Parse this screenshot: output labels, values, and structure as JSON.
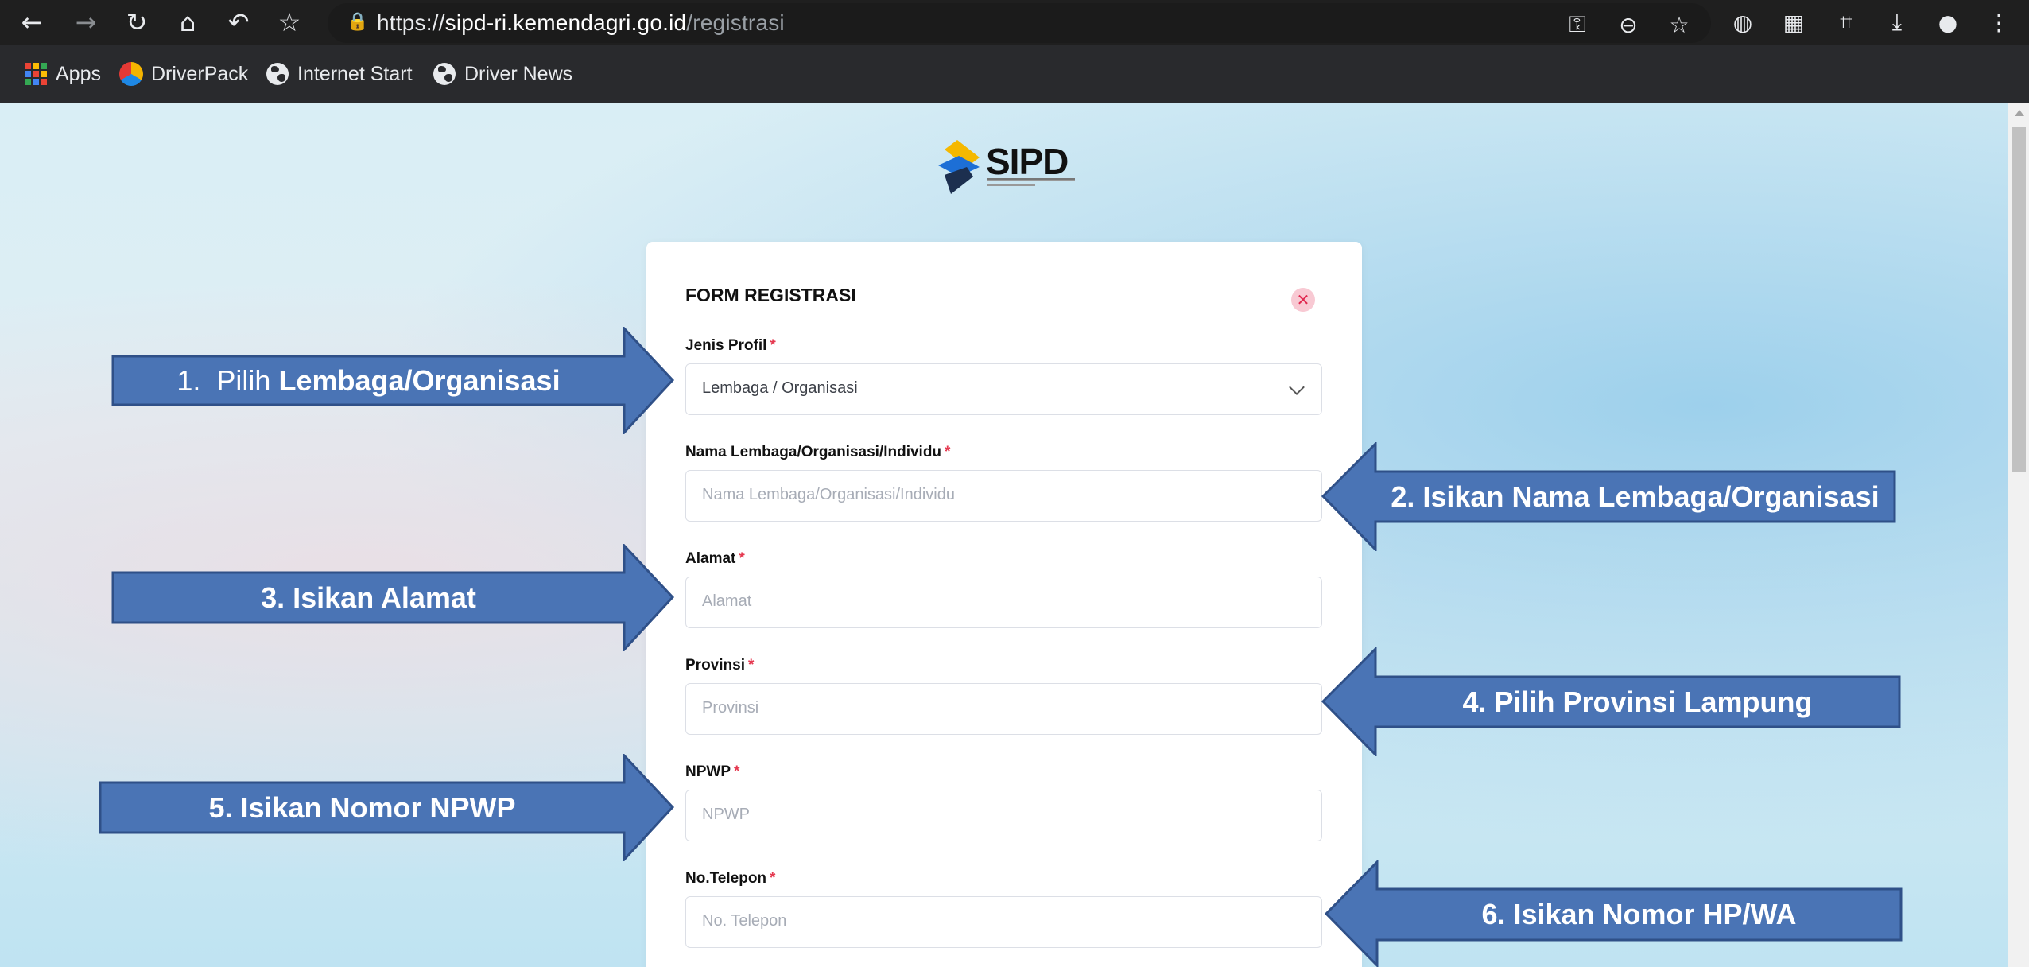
{
  "browser": {
    "url_scheme": "https://",
    "url_host": "sipd-ri.kemendagri.go.id",
    "url_path": "/registrasi",
    "bookmarks": [
      {
        "label": "Apps",
        "icon": "apps-grid-icon"
      },
      {
        "label": "DriverPack",
        "icon": "driverpack-icon"
      },
      {
        "label": "Internet Start",
        "icon": "globe-icon"
      },
      {
        "label": "Driver News",
        "icon": "globe-icon"
      }
    ]
  },
  "logo": {
    "text": "SIPD",
    "colors": {
      "yellow": "#f5b800",
      "blue": "#1d6fd6",
      "navy": "#1c2f4f"
    }
  },
  "form": {
    "title": "FORM REGISTRASI",
    "required_mark": "*",
    "fields": [
      {
        "label": "Jenis Profil",
        "value": "Lembaga / Organisasi",
        "type": "select"
      },
      {
        "label": "Nama Lembaga/Organisasi/Individu",
        "placeholder": "Nama Lembaga/Organisasi/Individu"
      },
      {
        "label": "Alamat",
        "placeholder": "Alamat"
      },
      {
        "label": "Provinsi",
        "placeholder": "Provinsi"
      },
      {
        "label": "NPWP",
        "placeholder": "NPWP"
      },
      {
        "label": "No.Telepon",
        "placeholder": "No. Telepon"
      }
    ]
  },
  "annotations": [
    {
      "prefix": "1.  Pilih ",
      "bold": "Lembaga/Organisasi"
    },
    {
      "prefix": "",
      "bold": "2. Isikan Nama Lembaga/Organisasi"
    },
    {
      "prefix": "",
      "bold": "3. Isikan Alamat"
    },
    {
      "prefix": "",
      "bold": "4. Pilih Provinsi Lampung"
    },
    {
      "prefix": "",
      "bold": "5. Isikan Nomor NPWP"
    },
    {
      "prefix": "",
      "bold": "6. Isikan Nomor HP/WA"
    }
  ],
  "colors": {
    "arrow_fill": "#4a74b5",
    "arrow_stroke": "#2f5088",
    "required": "#e53950",
    "close_bg": "#f8c9d3",
    "close_fg": "#e0284f"
  }
}
